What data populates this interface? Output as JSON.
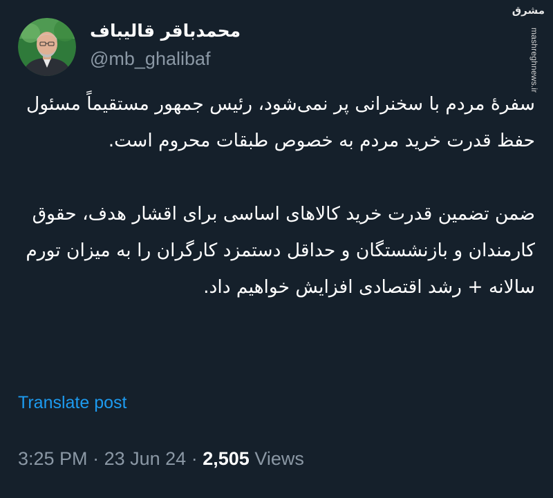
{
  "author": {
    "display_name": "محمدباقر قالیباف",
    "handle": "@mb_ghalibaf",
    "avatar_icon": "profile-photo"
  },
  "watermark": {
    "logo_text": "مشرق",
    "url": "mashreghnews.ir"
  },
  "post": {
    "paragraph_1": "سفرهٔ مردم با سخنرانی پر نمی‌شود، رئیس جمهور مستقیماً مسئول حفظ قدرت خرید مردم به خصوص طبقات محروم است.",
    "paragraph_2": "ضمن تضمین قدرت خرید کالاهای اساسی برای اقشار هدف، حقوق کارمندان و بازنشستگان و حداقل دستمزد کارگران را به میزان تورم سالانه + رشد اقتصادی افزایش خواهیم داد."
  },
  "translate_label": "Translate post",
  "meta": {
    "time": "3:25 PM",
    "separator": "·",
    "date": "23 Jun 24",
    "views_count": "2,505",
    "views_label": "Views"
  },
  "colors": {
    "background": "#15202b",
    "text": "#ffffff",
    "secondary": "#8b98a5",
    "link": "#1d9bf0"
  }
}
